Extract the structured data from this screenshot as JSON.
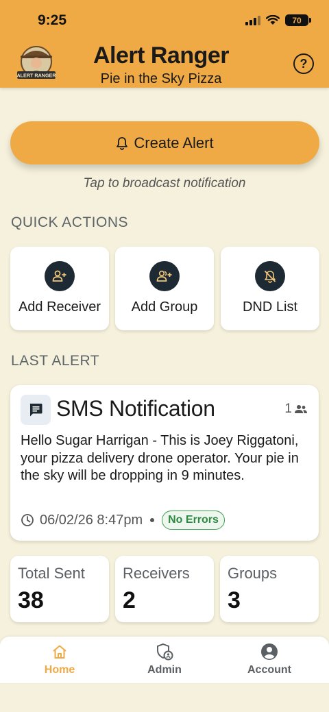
{
  "status_bar": {
    "time": "9:25",
    "battery": "70"
  },
  "header": {
    "title": "Alert Ranger",
    "subtitle": "Pie in the Sky Pizza",
    "logo_text": "ALERT RANGER",
    "help_glyph": "?"
  },
  "create_alert": {
    "label": "Create Alert",
    "hint": "Tap to broadcast notification",
    "icon": "bell-icon"
  },
  "quick_actions": {
    "title": "QUICK ACTIONS",
    "items": [
      {
        "label": "Add Receiver",
        "icon": "person-add-icon"
      },
      {
        "label": "Add Group",
        "icon": "group-add-icon"
      },
      {
        "label": "DND List",
        "icon": "bell-off-icon"
      }
    ]
  },
  "last_alert": {
    "title": "LAST ALERT",
    "type": "SMS Notification",
    "recipient_count": "1",
    "message": "Hello Sugar Harrigan - This is Joey Riggatoni, your pizza delivery drone operator. Your pie in the sky will be dropping in 9 minutes.",
    "timestamp": "06/02/26 8:47pm",
    "status": "No Errors"
  },
  "stats": [
    {
      "label": "Total Sent",
      "value": "38"
    },
    {
      "label": "Receivers",
      "value": "2"
    },
    {
      "label": "Groups",
      "value": "3"
    }
  ],
  "nav": {
    "items": [
      {
        "label": "Home",
        "icon": "home-icon"
      },
      {
        "label": "Admin",
        "icon": "shield-user-icon"
      },
      {
        "label": "Account",
        "icon": "account-icon"
      }
    ]
  },
  "colors": {
    "accent": "#efaa45",
    "background": "#f5f1dc",
    "success": "#2e8a41",
    "dark_icon": "#1e2a33"
  }
}
